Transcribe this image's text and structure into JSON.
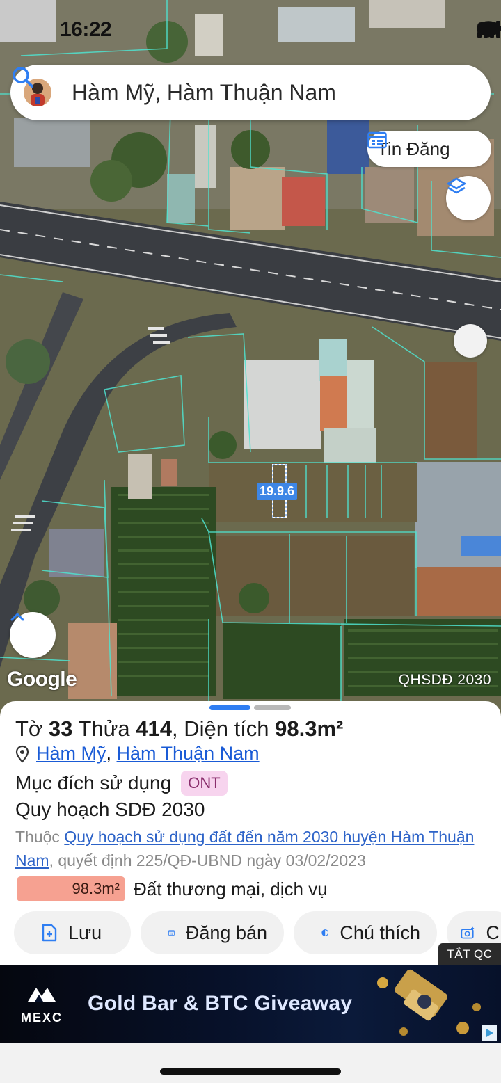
{
  "status_bar": {
    "time": "16:22"
  },
  "search": {
    "query": "Hàm Mỹ, Hàm Thuận Nam"
  },
  "map": {
    "tin_dang_label": "Tin Đăng",
    "parcel_label": "19.9.6",
    "google_label": "Google",
    "layer_label": "QHSDĐ 2030"
  },
  "parcel": {
    "title_prefix": "Tờ",
    "sheet_no": "33",
    "plot_label": "Thửa",
    "plot_no": "414",
    "area_label": ", Diện tích",
    "area_value": "98.3m²",
    "commune": "Hàm Mỹ",
    "district": "Hàm Thuận Nam",
    "purpose_label": "Mục đích sử dụng",
    "purpose_code": "ONT",
    "plan_title": "Quy hoạch SDĐ 2030",
    "plan_prefix": "Thuộc",
    "plan_link": "Quy hoạch sử dụng đất đến năm 2030 huyện Hàm Thuận Nam",
    "plan_suffix": ", quyết định 225/QĐ-UBND ngày 03/02/2023",
    "zone_area": "98.3m²",
    "zone_name": "Đất thương mại, dịch vụ"
  },
  "actions": {
    "save": "Lưu",
    "sell": "Đăng bán",
    "legend": "Chú thích",
    "more": "C"
  },
  "ad": {
    "close_label": "TẮT QC",
    "brand": "MEXC",
    "headline": "Gold Bar & BTC Giveaway"
  },
  "colors": {
    "accent": "#2f7ef2",
    "parcel_lines": "#4fe3d0",
    "zone_fill": "#f6a191",
    "ont_badge": "#f7d4ee"
  }
}
